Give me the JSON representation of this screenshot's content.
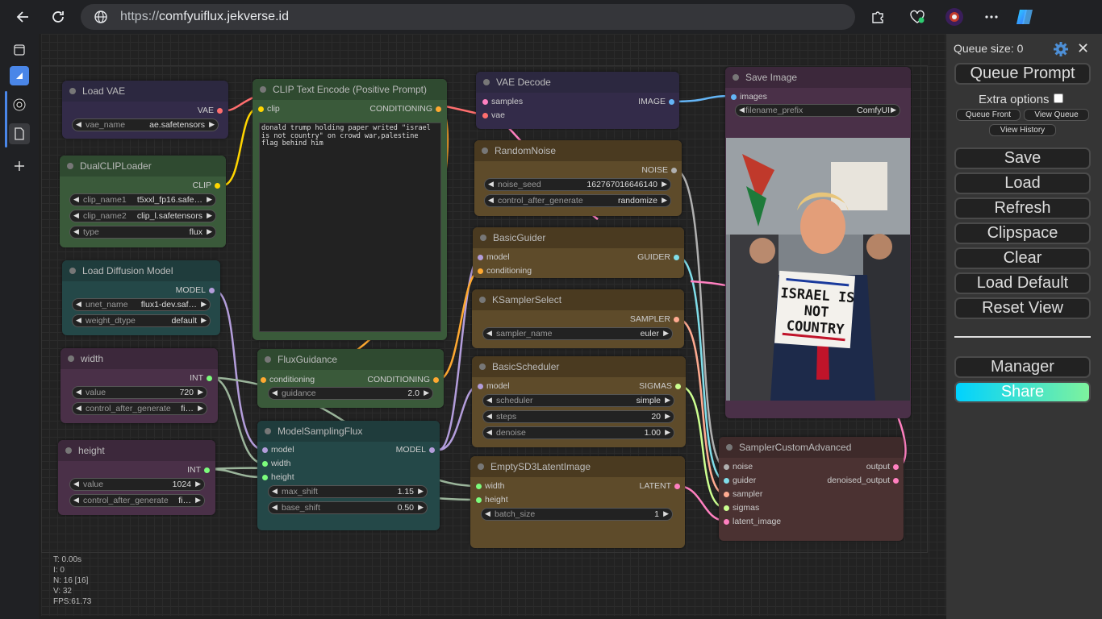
{
  "browser": {
    "url_prefix": "https://",
    "url_host": "comfyuiflux.jekverse.id"
  },
  "icons": {
    "back": "back-arrow-icon",
    "refresh": "refresh-icon",
    "site_info": "globe-icon",
    "extensions": "puzzle-icon",
    "health": "heart-pulse-icon",
    "profile": "avatar-icon",
    "more": "more-dots-icon",
    "copilot": "copilot-icon"
  },
  "nodes": {
    "load_vae": {
      "title": "Load VAE",
      "out": "VAE",
      "w_label": "vae_name",
      "w_value": "ae.safetensors"
    },
    "dual_clip": {
      "title": "DualCLIPLoader",
      "out": "CLIP",
      "w1_label": "clip_name1",
      "w1_value": "t5xxl_fp16.safe…",
      "w2_label": "clip_name2",
      "w2_value": "clip_l.safetensors",
      "w3_label": "type",
      "w3_value": "flux"
    },
    "load_model": {
      "title": "Load Diffusion Model",
      "out": "MODEL",
      "w1_label": "unet_name",
      "w1_value": "flux1-dev.saf…",
      "w2_label": "weight_dtype",
      "w2_value": "default"
    },
    "width": {
      "title": "width",
      "out": "INT",
      "w1_label": "value",
      "w1_value": "720",
      "w2_label": "control_after_generate",
      "w2_value": "fi…"
    },
    "height": {
      "title": "height",
      "out": "INT",
      "w1_label": "value",
      "w1_value": "1024",
      "w2_label": "control_after_generate",
      "w2_value": "fi…"
    },
    "clip_text": {
      "title": "CLIP Text Encode (Positive Prompt)",
      "in": "clip",
      "out": "CONDITIONING",
      "text": "donald trump holding paper writed \"israel is not country\" on crowd war,palestine flag behind him"
    },
    "flux_guidance": {
      "title": "FluxGuidance",
      "in": "conditioning",
      "out": "CONDITIONING",
      "w_label": "guidance",
      "w_value": "2.0"
    },
    "model_sampling": {
      "title": "ModelSamplingFlux",
      "in1": "model",
      "in2": "width",
      "in3": "height",
      "out": "MODEL",
      "w1_label": "max_shift",
      "w1_value": "1.15",
      "w2_label": "base_shift",
      "w2_value": "0.50"
    },
    "vae_decode": {
      "title": "VAE Decode",
      "in1": "samples",
      "in2": "vae",
      "out": "IMAGE"
    },
    "random_noise": {
      "title": "RandomNoise",
      "out": "NOISE",
      "w1_label": "noise_seed",
      "w1_value": "162767016646140",
      "w2_label": "control_after_generate",
      "w2_value": "randomize"
    },
    "basic_guider": {
      "title": "BasicGuider",
      "in1": "model",
      "in2": "conditioning",
      "out": "GUIDER"
    },
    "ksampler_select": {
      "title": "KSamplerSelect",
      "out": "SAMPLER",
      "w_label": "sampler_name",
      "w_value": "euler"
    },
    "basic_scheduler": {
      "title": "BasicScheduler",
      "in": "model",
      "out": "SIGMAS",
      "w1_label": "scheduler",
      "w1_value": "simple",
      "w2_label": "steps",
      "w2_value": "20",
      "w3_label": "denoise",
      "w3_value": "1.00"
    },
    "empty_latent": {
      "title": "EmptySD3LatentImage",
      "in1": "width",
      "in2": "height",
      "out": "LATENT",
      "w_label": "batch_size",
      "w_value": "1"
    },
    "save_image": {
      "title": "Save Image",
      "in": "images",
      "w_label": "filename_prefix",
      "w_value": "ComfyUI",
      "sign_text": "ISRAEL IS NOT COUNTRY"
    },
    "sampler_custom": {
      "title": "SamplerCustomAdvanced",
      "in1": "noise",
      "in2": "guider",
      "in3": "sampler",
      "in4": "sigmas",
      "in5": "latent_image",
      "out1": "output",
      "out2": "denoised_output"
    }
  },
  "stats": {
    "t": "T: 0.00s",
    "i": "I: 0",
    "n": "N: 16 [16]",
    "v": "V: 32",
    "fps": "FPS:61.73"
  },
  "menu": {
    "queue_size": "Queue size: 0",
    "queue_prompt": "Queue Prompt",
    "extra_options": "Extra options",
    "queue_front": "Queue Front",
    "view_queue": "View Queue",
    "view_history": "View History",
    "save": "Save",
    "load": "Load",
    "refresh": "Refresh",
    "clipspace": "Clipspace",
    "clear": "Clear",
    "load_default": "Load Default",
    "reset_view": "Reset View",
    "manager": "Manager",
    "share": "Share"
  },
  "colors": {
    "accent_blue": "#4a86e8",
    "share_gradient_start": "#00d2ff",
    "share_gradient_end": "#7ef29d"
  }
}
